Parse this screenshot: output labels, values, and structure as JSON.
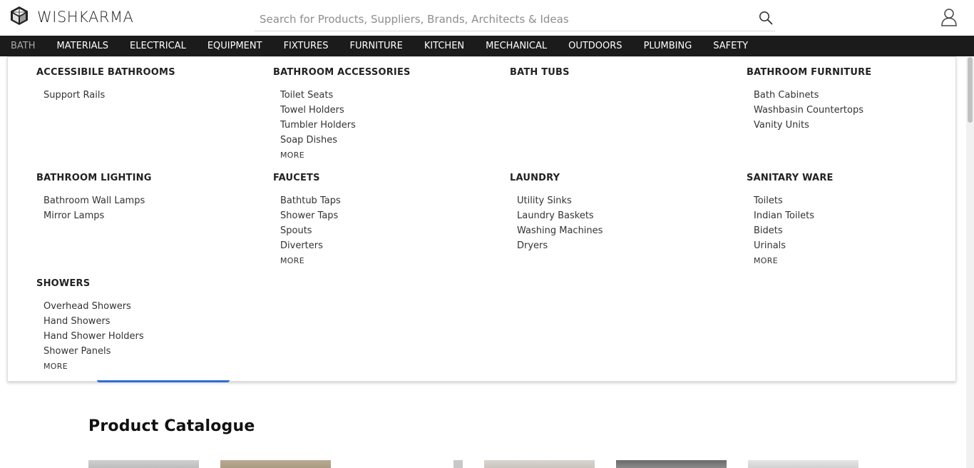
{
  "brand": {
    "name": "WISHKARMA",
    "logo_icon": "cube-logo-icon"
  },
  "search": {
    "placeholder": "Search for Products, Suppliers, Brands, Architects & Ideas",
    "value": ""
  },
  "nav": [
    {
      "label": "BATH",
      "active": true
    },
    {
      "label": "MATERIALS"
    },
    {
      "label": "ELECTRICAL"
    },
    {
      "label": "EQUIPMENT"
    },
    {
      "label": "FIXTURES"
    },
    {
      "label": "FURNITURE"
    },
    {
      "label": "KITCHEN"
    },
    {
      "label": "MECHANICAL"
    },
    {
      "label": "OUTDOORS"
    },
    {
      "label": "PLUMBING"
    },
    {
      "label": "SAFETY"
    }
  ],
  "mega": {
    "more_label": "MORE",
    "categories": [
      {
        "title": "ACCESSIBILE BATHROOMS",
        "items": [
          "Support Rails"
        ],
        "more": false
      },
      {
        "title": "BATHROOM ACCESSORIES",
        "items": [
          "Toilet Seats",
          "Towel Holders",
          "Tumbler Holders",
          "Soap Dishes"
        ],
        "more": true
      },
      {
        "title": "BATH TUBS",
        "items": [],
        "more": false
      },
      {
        "title": "BATHROOM FURNITURE",
        "items": [
          "Bath Cabinets",
          "Washbasin Countertops",
          "Vanity Units"
        ],
        "more": false
      },
      {
        "title": "BATHROOM LIGHTING",
        "items": [
          "Bathroom Wall Lamps",
          "Mirror Lamps"
        ],
        "more": false
      },
      {
        "title": "FAUCETS",
        "items": [
          "Bathtub Taps",
          "Shower Taps",
          "Spouts",
          "Diverters"
        ],
        "more": true
      },
      {
        "title": "LAUNDRY",
        "items": [
          "Utility Sinks",
          "Laundry Baskets",
          "Washing Machines",
          "Dryers"
        ],
        "more": false
      },
      {
        "title": "SANITARY WARE",
        "items": [
          "Toilets",
          "Indian Toilets",
          "Bidets",
          "Urinals"
        ],
        "more": true
      },
      {
        "title": "SHOWERS",
        "items": [
          "Overhead Showers",
          "Hand Showers",
          "Hand Shower Holders",
          "Shower Panels"
        ],
        "more": true
      }
    ]
  },
  "page": {
    "section_title": "Product Catalogue"
  },
  "colors": {
    "nav_bg": "#1b1b1b",
    "accent_blue": "#2f6ed8"
  }
}
